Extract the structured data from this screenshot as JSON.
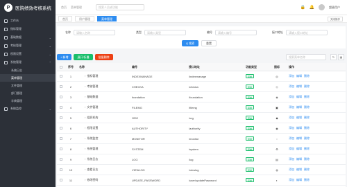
{
  "brand": {
    "title": "医院绩效考核系统"
  },
  "sidebar": {
    "items": [
      {
        "label": "工作台",
        "icon": "dashboard-icon"
      },
      {
        "label": "指标管理",
        "icon": "list-icon"
      },
      {
        "label": "基础数据",
        "icon": "database-icon"
      },
      {
        "label": "考核管理",
        "icon": "check-icon"
      },
      {
        "label": "权限设置",
        "icon": "lock-icon"
      },
      {
        "label": "系统管理",
        "icon": "settings-icon"
      },
      {
        "label": "系统日志",
        "icon": "log-icon"
      },
      {
        "label": "菜单管理",
        "icon": "menu-icon"
      },
      {
        "label": "文件管理",
        "icon": "file-icon"
      },
      {
        "label": "部门管理",
        "icon": "dept-icon"
      },
      {
        "label": "字典管理",
        "icon": "dict-icon"
      },
      {
        "label": "系统监控",
        "icon": "monitor-icon"
      }
    ]
  },
  "header": {
    "breadcrumb": [
      "首页",
      "菜单管理"
    ],
    "search_placeholder": "搜索人员或功能",
    "user_name": "超级用户"
  },
  "tabs": {
    "items": [
      "首页",
      "用户管理",
      "菜单管理"
    ],
    "active": "菜单管理",
    "close_label": "关闭操作"
  },
  "search": {
    "fields": [
      {
        "label": "名称",
        "placeholder": "请输入名称"
      },
      {
        "label": "类型",
        "placeholder": "请输入类型"
      },
      {
        "label": "编号",
        "placeholder": "请输入编号"
      },
      {
        "label": "接口地址",
        "placeholder": "请输入接口地址"
      }
    ],
    "search_label": "Q 搜索",
    "reset_label": "重置"
  },
  "toolbar": {
    "add_label": "+ 新增",
    "expand_label": "展开/折叠",
    "delete_label": "批量删除",
    "filter_placeholder": "搜索菜单名称"
  },
  "table": {
    "columns": [
      "序号",
      "名称",
      "编号",
      "接口地址",
      "功能类型",
      "图标",
      "操作"
    ],
    "rows": [
      {
        "order": "1",
        "name": "指标管理",
        "code": "INDEXMANAGE",
        "path": "/indexmanage",
        "type": "菜单"
      },
      {
        "order": "2",
        "name": "考核管理",
        "code": "CHECKA",
        "path": "/checka",
        "type": "菜单"
      },
      {
        "order": "3",
        "name": "基础数据",
        "code": "foundation",
        "path": "/foundation",
        "type": "菜单"
      },
      {
        "order": "4",
        "name": "文件管理",
        "code": "FILEMG",
        "path": "/filemg",
        "type": "菜单"
      },
      {
        "order": "5",
        "name": "组织机构",
        "code": "ORG",
        "path": "/org",
        "type": "菜单"
      },
      {
        "order": "6",
        "name": "权限设置",
        "code": "AUTHORITY",
        "path": "/authority",
        "type": "菜单"
      },
      {
        "order": "7",
        "name": "系统监控",
        "code": "MONITOR",
        "path": "/monitor",
        "type": "菜单"
      },
      {
        "order": "8",
        "name": "系统管理",
        "code": "SYSTEM",
        "path": "/system",
        "type": "菜单"
      },
      {
        "order": "9",
        "name": "系统日志",
        "code": "LOG",
        "path": "/log",
        "type": "菜单"
      },
      {
        "order": "10",
        "name": "查看日志",
        "code": "VIEWLOG",
        "path": "/viewlog",
        "type": "菜单"
      },
      {
        "order": "11",
        "name": "修改密码",
        "code": "UPDATE_PASSWORD",
        "path": "/user/updatePassword",
        "type": "菜单"
      }
    ],
    "ops": [
      "添加",
      "编辑",
      "删除"
    ]
  }
}
